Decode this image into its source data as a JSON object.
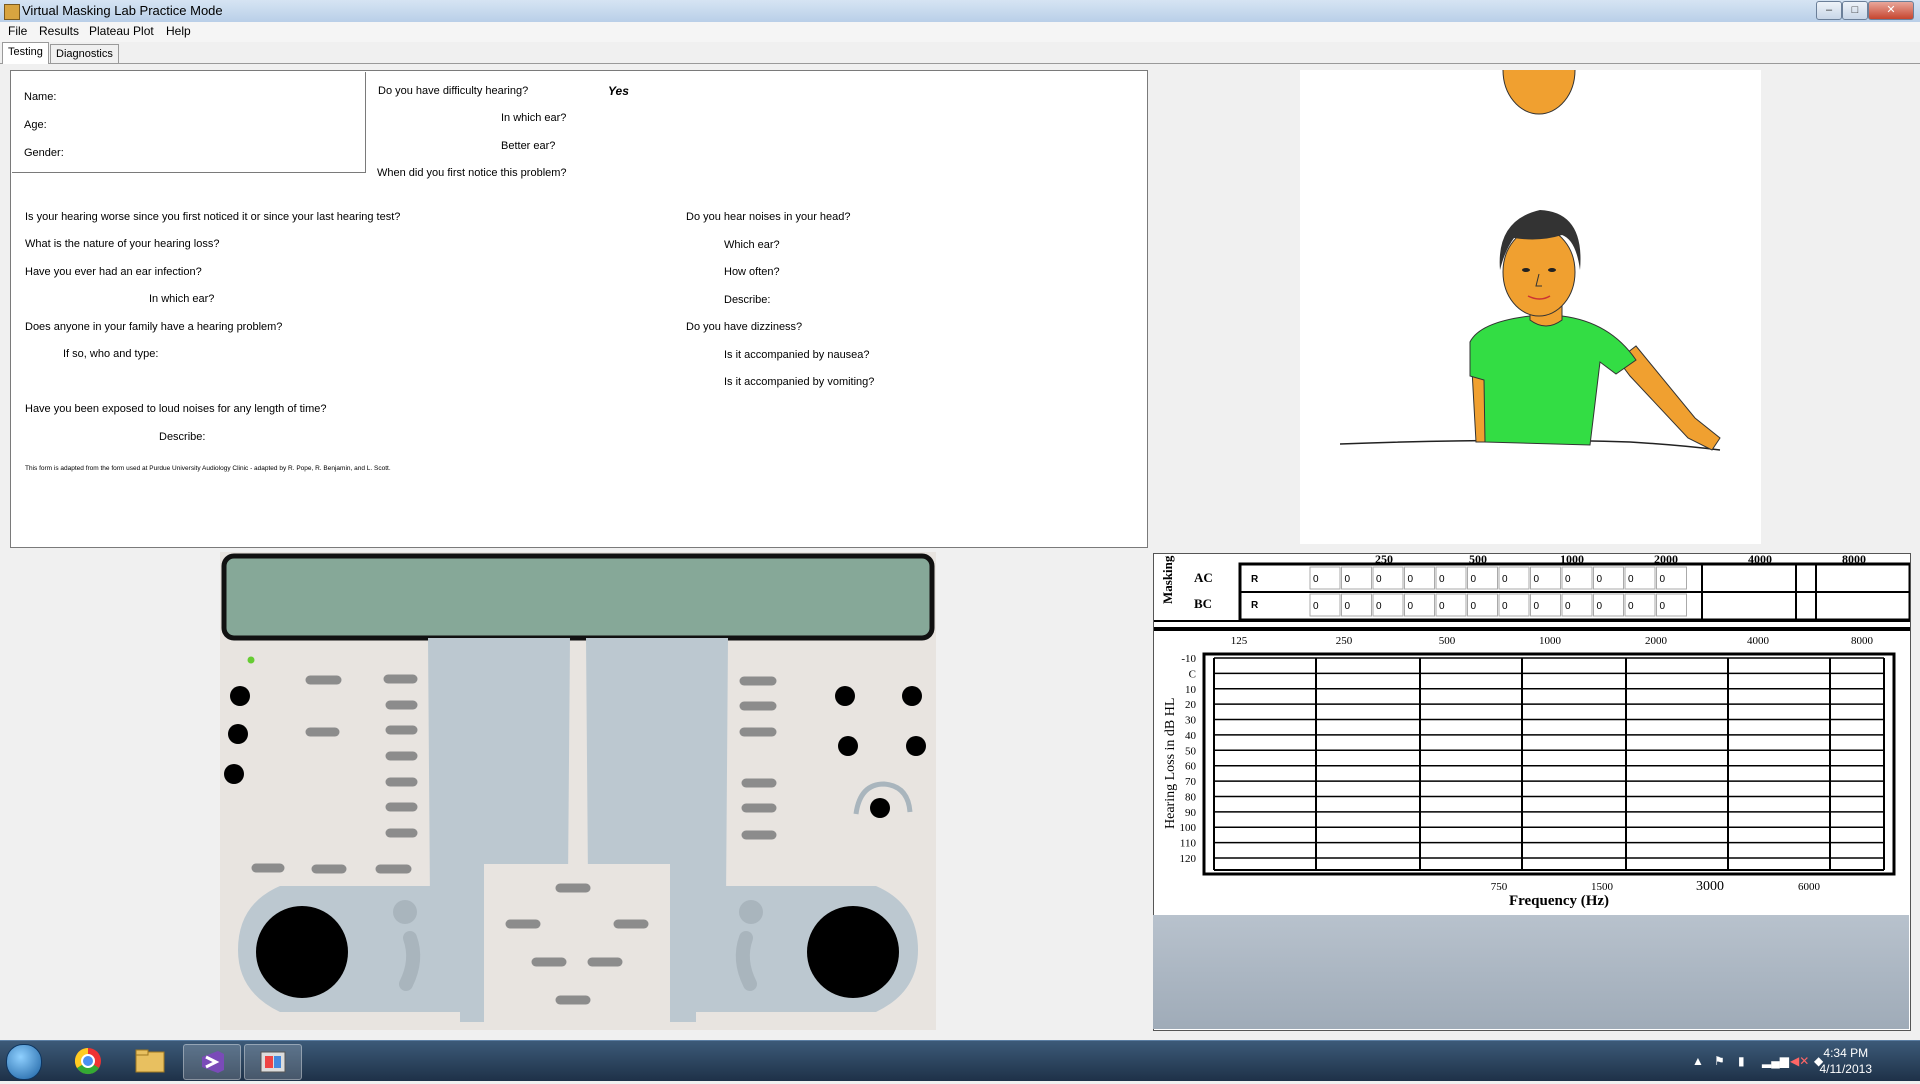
{
  "window": {
    "title": "Virtual Masking Lab Practice Mode",
    "controls": [
      "–",
      "□",
      "✕"
    ]
  },
  "menu": [
    "File",
    "Results",
    "Plateau Plot",
    "Help"
  ],
  "tabs": [
    "Testing",
    "Diagnostics"
  ],
  "form": {
    "name": "Name:",
    "age": "Age:",
    "gender": "Gender:",
    "q_difficulty": "Do you have difficulty hearing?",
    "a_difficulty": "Yes",
    "q_which_ear": "In which ear?",
    "q_better_ear": "Better ear?",
    "q_first_notice": "When did you first notice this problem?",
    "q_worse": "Is your hearing worse since you first noticed it or since your last hearing test?",
    "q_nature": "What is the nature of your hearing loss?",
    "q_infection": "Have you ever had an ear infection?",
    "q_infection_ear": "In which ear?",
    "q_family": "Does anyone in your family have a hearing problem?",
    "q_family_who": "If so, who and type:",
    "q_loud": "Have you been exposed to loud noises for any length of time?",
    "q_loud_describe": "Describe:",
    "note": "This form is adapted from the form used at Purdue University Audiology Clinic - adapted by R. Pope, R. Benjamin, and L. Scott.",
    "q_noises": "Do you hear noises in your head?",
    "q_noises_ear": "Which ear?",
    "q_noises_often": "How often?",
    "q_noises_describe": "Describe:",
    "q_dizzy": "Do you have dizziness?",
    "q_nausea": "Is it accompanied by nausea?",
    "q_vomiting": "Is it accompanied by vomiting?"
  },
  "masking": {
    "title": "Masking",
    "rows": [
      "AC",
      "BC"
    ],
    "ear": "R",
    "top_freqs": [
      "250",
      "500",
      "1000",
      "2000",
      "4000",
      "8000"
    ],
    "ac_values": [
      "0",
      "0",
      "0",
      "0",
      "0",
      "0",
      "0",
      "0",
      "0",
      "0",
      "0",
      "0"
    ],
    "bc_values": [
      "0",
      "0",
      "0",
      "0",
      "0",
      "0",
      "0",
      "0",
      "0",
      "0",
      "0",
      "0"
    ]
  },
  "audiogram": {
    "freq_top": [
      "125",
      "250",
      "500",
      "1000",
      "2000",
      "4000",
      "8000"
    ],
    "db_levels": [
      "-10",
      "C",
      "10",
      "20",
      "30",
      "40",
      "50",
      "60",
      "70",
      "80",
      "90",
      "100",
      "110",
      "120"
    ],
    "freq_bottom": [
      "750",
      "1500",
      "3000",
      "6000"
    ],
    "xlabel": "Frequency (Hz)",
    "ylabel": "Hearing Loss in dB HL"
  },
  "colors": {
    "display": "#86a898",
    "panel": "#bcc8d0",
    "shirt": "#33dd44",
    "skin": "#f0a030",
    "led": "#66cc33"
  },
  "taskbar": {
    "time": "4:34 PM",
    "date": "4/11/2013",
    "apps": [
      "start-orb",
      "chrome-icon",
      "explorer-icon",
      "visual-studio-icon",
      "app-icon"
    ]
  }
}
